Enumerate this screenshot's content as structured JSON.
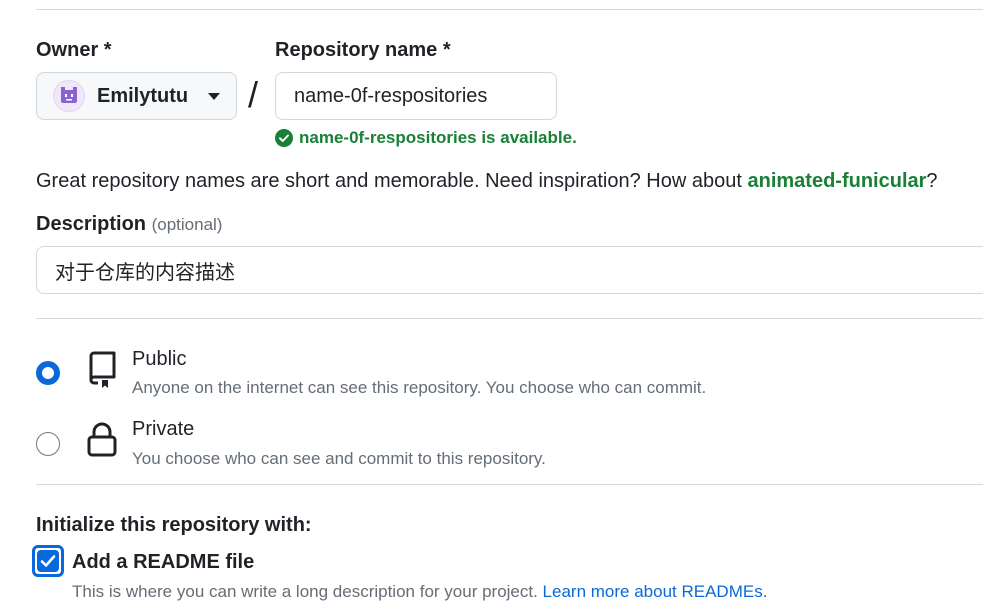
{
  "owner": {
    "label": "Owner *",
    "selected": "Emilytutu"
  },
  "repository": {
    "label": "Repository name *",
    "value": "name-0f-respositories",
    "availability": "name-0f-respositories is available."
  },
  "separator": "/",
  "inspiration": {
    "text": "Great repository names are short and memorable. Need inspiration? How about ",
    "suggestion": "animated-funicular",
    "suffix": "?"
  },
  "description": {
    "label": "Description",
    "optional": "(optional)",
    "value": "对于仓库的内容描述"
  },
  "visibility": {
    "public": {
      "title": "Public",
      "description": "Anyone on the internet can see this repository. You choose who can commit.",
      "selected": true
    },
    "private": {
      "title": "Private",
      "description": "You choose who can see and commit to this repository.",
      "selected": false
    }
  },
  "initialize": {
    "label": "Initialize this repository with:",
    "readme": {
      "label": "Add a README file",
      "description": "This is where you can write a long description for your project. ",
      "link": "Learn more about READMEs.",
      "checked": true
    }
  },
  "colors": {
    "accent": "#0969da",
    "success": "#1a7f37",
    "muted": "#656d76"
  }
}
